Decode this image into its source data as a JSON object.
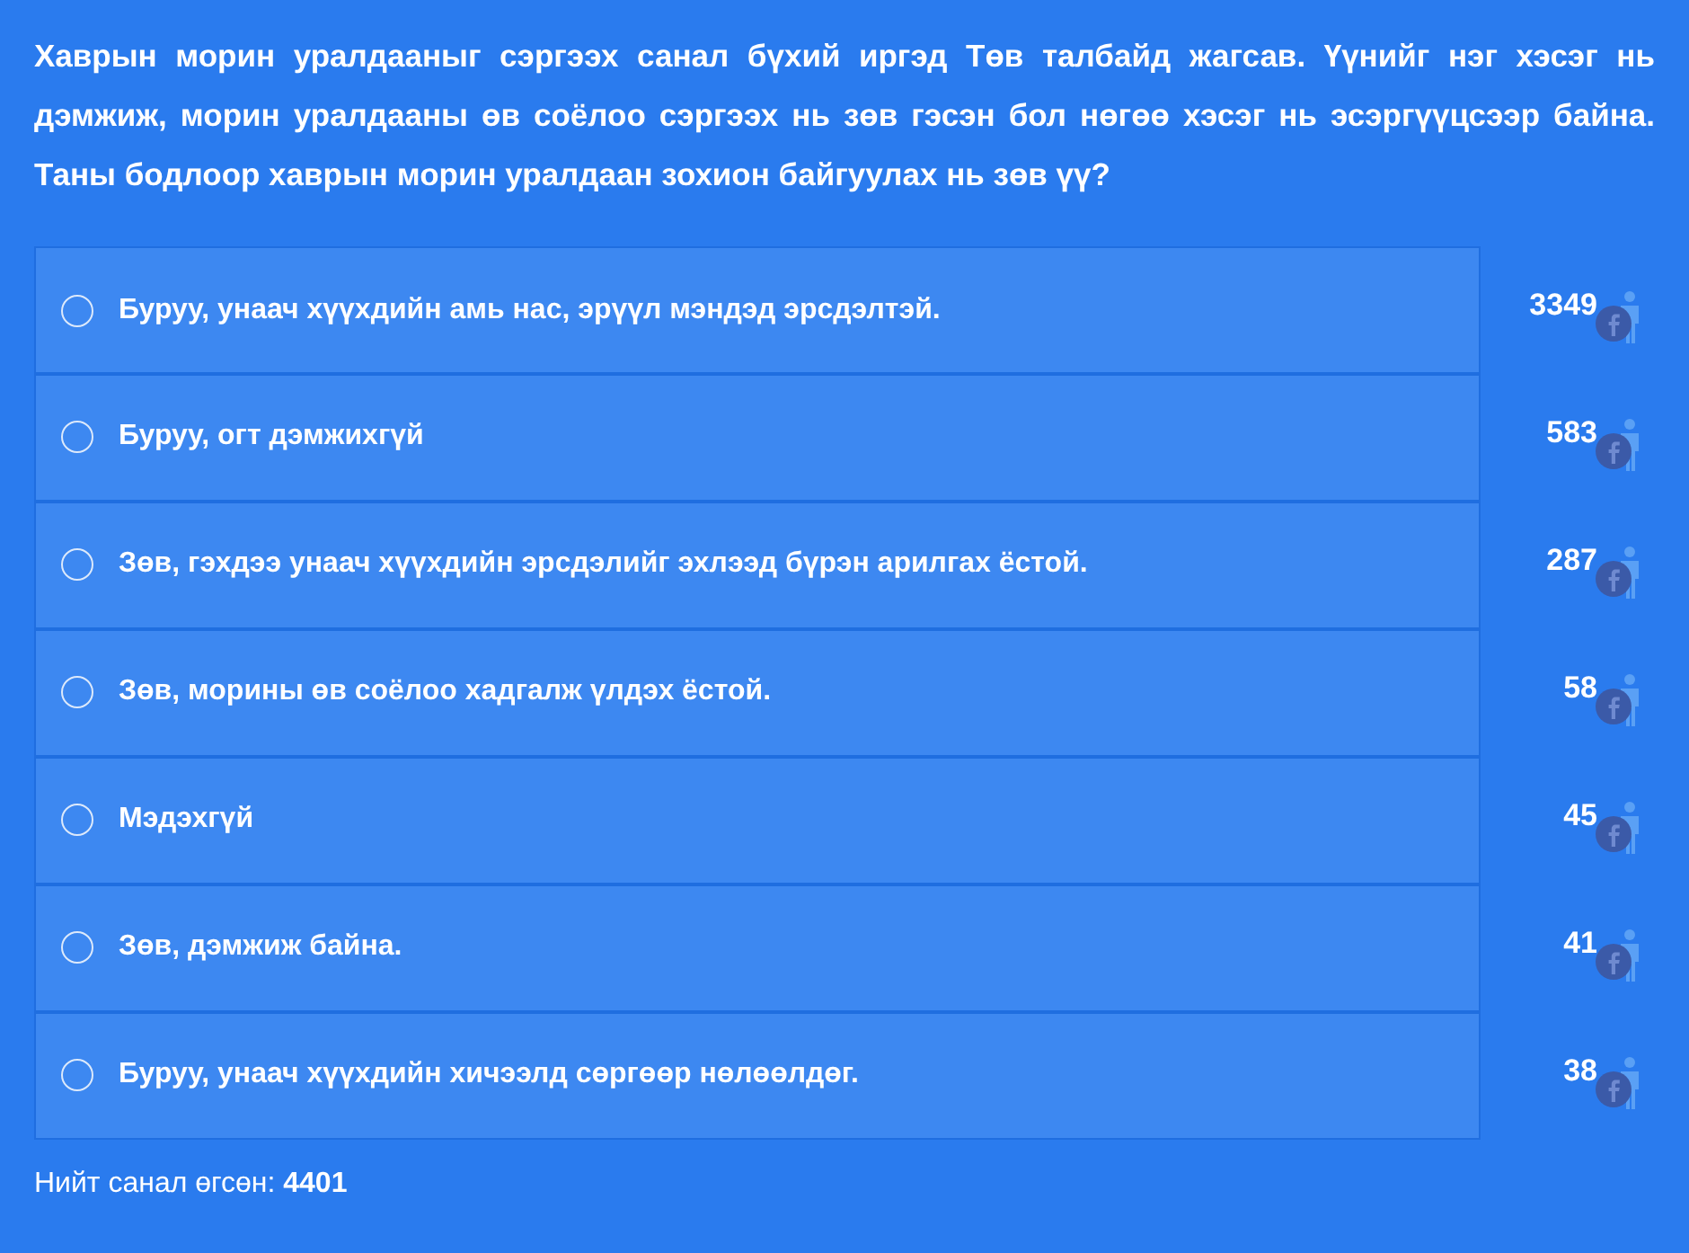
{
  "question": "Хаврын морин уралдааныг сэргээх санал бүхий иргэд Төв талбайд жагсав. Үүнийг нэг хэсэг нь дэмжиж, морин уралдааны өв соёлоо сэргээх нь зөв гэсэн бол нөгөө хэсэг нь эсэргүүцсээр байна. Таны бодлоор хаврын морин уралдаан зохион байгуулах нь зөв үү?",
  "options": [
    {
      "label": "Буруу, унаач хүүхдийн амь нас, эрүүл мэндэд эрсдэлтэй.",
      "count": "3349",
      "selected": false
    },
    {
      "label": "Буруу, огт дэмжихгүй",
      "count": "583",
      "selected": false
    },
    {
      "label": "Зөв, гэхдээ унаач хүүхдийн эрсдэлийг эхлээд бүрэн арилгах ёстой.",
      "count": "287",
      "selected": false
    },
    {
      "label": "Зөв, морины өв соёлоо хадгалж үлдэх ёстой.",
      "count": "58",
      "selected": false
    },
    {
      "label": "Мэдэхгүй",
      "count": "45",
      "selected": false
    },
    {
      "label": "Зөв, дэмжиж байна.",
      "count": "41",
      "selected": false
    },
    {
      "label": "Буруу, унаач хүүхдийн хичээлд сөргөөр нөлөөлдөг.",
      "count": "38",
      "selected": false
    }
  ],
  "total": "Нийт санал өгсөн: **4401**"
}
